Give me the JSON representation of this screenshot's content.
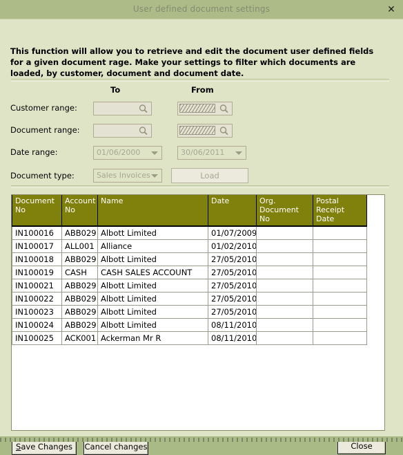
{
  "window": {
    "title": "User defined document settings",
    "close_icon": "close-x-icon"
  },
  "intro": {
    "text": "This function will allow you to retrieve and edit the document user defined fields for a given document rage. Make your settings to filter which documents are loaded, by customer, document and document date."
  },
  "filters": {
    "captions": {
      "to": "To",
      "from": "From"
    },
    "labels": {
      "customer_range": "Customer range:",
      "document_range": "Document range:",
      "date_range": "Date range:",
      "document_type": "Document type:"
    },
    "customer_range": {
      "to_value": "",
      "from_value": "",
      "lookup_icon": "magnifier-icon"
    },
    "document_range": {
      "to_value": "",
      "from_value": "",
      "lookup_icon": "magnifier-icon"
    },
    "date_range": {
      "to_value": "01/06/2000",
      "from_value": "30/06/2011",
      "dropdown_icon": "chevron-down-icon"
    },
    "document_type": {
      "value": "Sales Invoices",
      "dropdown_icon": "chevron-down-icon"
    },
    "load_button": "Load"
  },
  "grid": {
    "columns": [
      "Document No",
      "Account No",
      "Name",
      "Date",
      "Org. Document No",
      "Postal Receipt Date"
    ],
    "rows": [
      {
        "document_no": "IN100016",
        "account_no": "ABB029",
        "name": "Albott Limited",
        "date": "01/07/2009",
        "org_document_no": "",
        "postal_receipt_date": ""
      },
      {
        "document_no": "IN100017",
        "account_no": "ALL001",
        "name": "Alliance",
        "date": "01/02/2010",
        "org_document_no": "",
        "postal_receipt_date": ""
      },
      {
        "document_no": "IN100018",
        "account_no": "ABB029",
        "name": "Albott Limited",
        "date": "27/05/2010",
        "org_document_no": "",
        "postal_receipt_date": ""
      },
      {
        "document_no": "IN100019",
        "account_no": "CASH",
        "name": "CASH SALES ACCOUNT",
        "date": "27/05/2010",
        "org_document_no": "",
        "postal_receipt_date": ""
      },
      {
        "document_no": "IN100021",
        "account_no": "ABB029",
        "name": "Albott Limited",
        "date": "27/05/2010",
        "org_document_no": "",
        "postal_receipt_date": ""
      },
      {
        "document_no": "IN100022",
        "account_no": "ABB029",
        "name": "Albott Limited",
        "date": "27/05/2010",
        "org_document_no": "",
        "postal_receipt_date": ""
      },
      {
        "document_no": "IN100023",
        "account_no": "ABB029",
        "name": "Albott Limited",
        "date": "27/05/2010",
        "org_document_no": "",
        "postal_receipt_date": ""
      },
      {
        "document_no": "IN100024",
        "account_no": "ABB029",
        "name": "Albott Limited",
        "date": "08/11/2010",
        "org_document_no": "",
        "postal_receipt_date": ""
      },
      {
        "document_no": "IN100025",
        "account_no": "ACK001",
        "name": "Ackerman Mr R",
        "date": "08/11/2010",
        "org_document_no": "",
        "postal_receipt_date": ""
      }
    ]
  },
  "footer": {
    "save_accel": "S",
    "save_rest": "ave Changes",
    "cancel": "Cancel changes",
    "close": "Close"
  },
  "colors": {
    "titlebar": "#adbb88",
    "dialog_bg": "#dfe4c6",
    "grid_header": "#80800d",
    "desktop": "#a9ba86"
  }
}
